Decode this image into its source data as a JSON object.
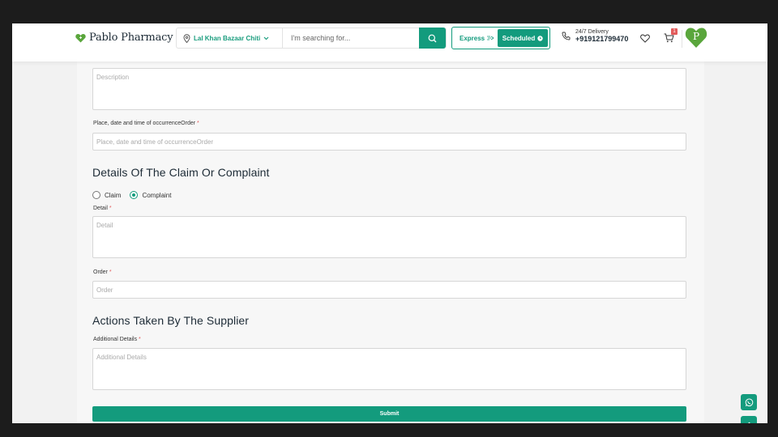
{
  "header": {
    "logo_text": "Pablo Pharmacy",
    "location": "Lal Khan Bazaar Chiti",
    "search_placeholder": "I'm searching for...",
    "express_label": "Express",
    "scheduled_label": "Scheduled",
    "delivery_line1": "24/7 Delivery",
    "phone_number": "+919121799470",
    "cart_count": "1",
    "avatar_letter": "P"
  },
  "form": {
    "description_placeholder": "Description",
    "place_label": "Place, date and time of occurrenceOrder",
    "place_placeholder": "Place, date and time of occurrenceOrder",
    "claim_section_title": "Details Of The Claim Or Complaint",
    "radio_claim": "Claim",
    "radio_complaint": "Complaint",
    "selected_radio": "Complaint",
    "detail_label": "Detail",
    "detail_placeholder": "Detail",
    "order_label": "Order",
    "order_placeholder": "Order",
    "actions_section_title": "Actions Taken By The Supplier",
    "additional_label": "Additional Details",
    "additional_placeholder": "Additional Details",
    "required_mark": "*",
    "submit_label": "Submit"
  },
  "colors": {
    "brand": "#139b7d",
    "badge": "#e25b5b",
    "logo_green": "#5aa63c"
  }
}
